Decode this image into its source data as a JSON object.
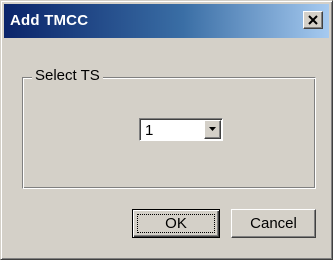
{
  "window": {
    "title": "Add TMCC"
  },
  "titlebar": {
    "close_icon": "close-x-icon"
  },
  "group": {
    "label": "Select TS"
  },
  "select_ts": {
    "selected_value": "1",
    "arrow_icon": "chevron-down-icon"
  },
  "buttons": {
    "ok_label": "OK",
    "cancel_label": "Cancel"
  },
  "colors": {
    "titlebar_start": "#0a246a",
    "titlebar_end": "#a6caf0",
    "dialog_face": "#d4d0c8"
  }
}
